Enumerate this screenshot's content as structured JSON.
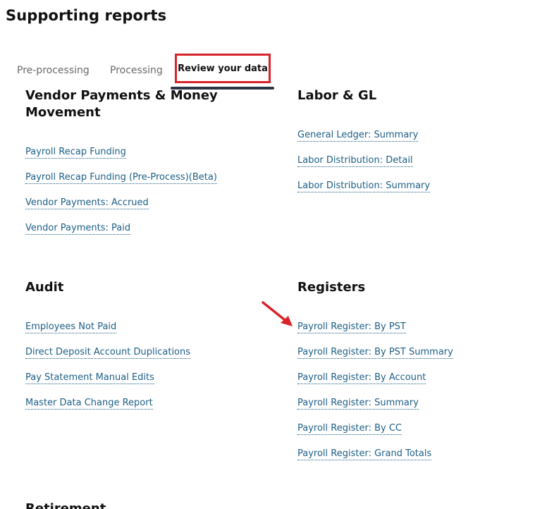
{
  "page": {
    "title": "Supporting reports"
  },
  "tabs": [
    {
      "label": "Pre-processing",
      "active": false
    },
    {
      "label": "Processing",
      "active": false
    },
    {
      "label": "Review your data",
      "active": true
    }
  ],
  "sections": {
    "vendor": {
      "title": "Vendor Payments & Money Movement",
      "links": [
        "Payroll Recap Funding",
        "Payroll Recap Funding (Pre-Process)(Beta)",
        "Vendor Payments: Accrued",
        "Vendor Payments: Paid"
      ]
    },
    "labor": {
      "title": "Labor & GL",
      "links": [
        "General Ledger: Summary",
        "Labor Distribution: Detail",
        "Labor Distribution: Summary"
      ]
    },
    "audit": {
      "title": "Audit",
      "links": [
        "Employees Not Paid",
        "Direct Deposit Account Duplications",
        "Pay Statement Manual Edits",
        "Master Data Change Report"
      ]
    },
    "registers": {
      "title": "Registers",
      "links": [
        "Payroll Register: By PST",
        "Payroll Register: By PST Summary",
        "Payroll Register: By Account",
        "Payroll Register: Summary",
        "Payroll Register: By CC",
        "Payroll Register: Grand Totals"
      ]
    },
    "retirement": {
      "title": "Retirement"
    }
  },
  "colors": {
    "link": "#1d5f86",
    "highlight": "#d9232a",
    "tab_underline": "#2a3444"
  }
}
